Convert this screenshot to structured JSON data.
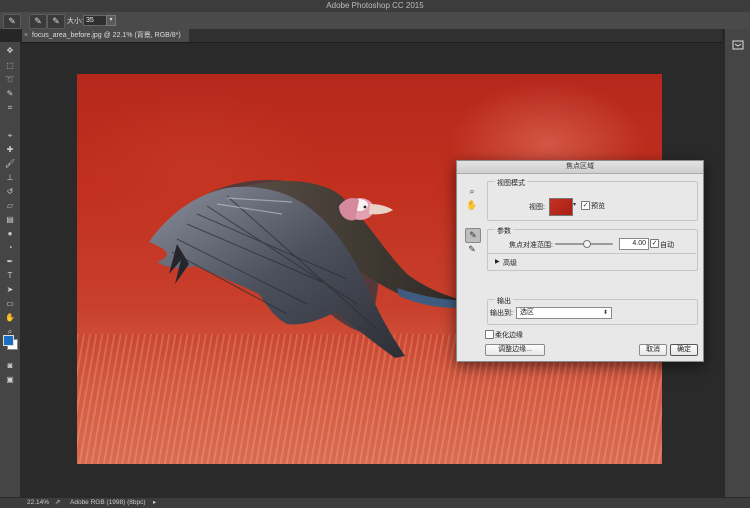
{
  "window": {
    "title": "Adobe Photoshop CC 2015"
  },
  "options_bar": {
    "size_label": "大小:",
    "size_value": "35"
  },
  "document_tab": {
    "close": "×",
    "name": "focus_area_before.jpg @ 22.1% (背景, RGB/8*)"
  },
  "statusbar": {
    "zoom": "22.14%",
    "profile": "Adobe RGB (1998) (8bpc)"
  },
  "dialog": {
    "title": "焦点区域",
    "view_mode": {
      "group_label": "视图模式",
      "view_label": "视图:",
      "preview_label": "预览",
      "preview_checked": true
    },
    "params": {
      "group_label": "参数",
      "range_label": "焦点对准范围:",
      "range_value": "4.00",
      "slider_level": 0.55,
      "auto_label": "自动",
      "auto_checked": true,
      "advanced_label": "高级"
    },
    "output": {
      "group_label": "输出",
      "output_to_label": "输出到:",
      "output_to_value": "选区"
    },
    "soften_edge_label": "柔化边缘",
    "soften_edge_checked": false,
    "buttons": {
      "refine_edge": "调整边缘...",
      "cancel": "取消",
      "ok": "确定"
    }
  },
  "colors": {
    "foreground": "#1b6fc3",
    "background": "#ffffff",
    "photo_red": "#c2301f"
  },
  "icons": {
    "left_tools": [
      "move-icon",
      "marquee-icon",
      "lasso-icon",
      "quick-select-icon",
      "crop-icon",
      "eyedropper-icon",
      "healing-brush-icon",
      "brush-icon",
      "clone-stamp-icon",
      "history-brush-icon",
      "eraser-icon",
      "gradient-icon",
      "blur-icon",
      "dodge-icon",
      "pen-icon",
      "type-icon",
      "path-select-icon",
      "rectangle-icon",
      "hand-icon",
      "zoom-icon"
    ]
  }
}
